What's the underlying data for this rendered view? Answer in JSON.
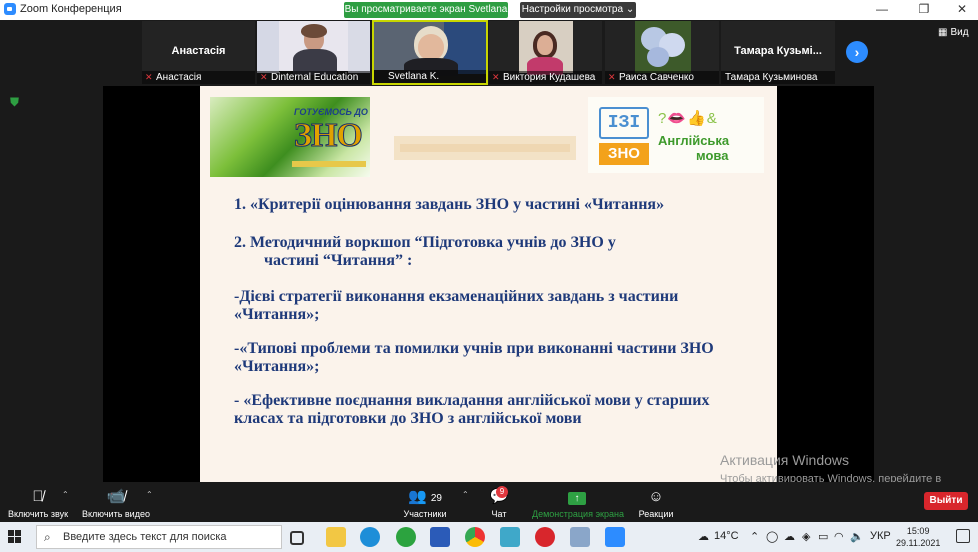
{
  "window": {
    "title": "Zoom Конференция",
    "share_notice": "Вы просматриваете экран Svetlana K",
    "view_options": "Настройки просмотра",
    "controls": [
      "—",
      "❐",
      "✕"
    ]
  },
  "participants": [
    {
      "display": "Анастасія",
      "caption": "Анастасія",
      "video": false
    },
    {
      "display": "",
      "caption": "Dinternal Education",
      "video": true
    },
    {
      "display": "",
      "caption": "Svetlana K.",
      "video": true
    },
    {
      "display": "",
      "caption": "Виктория Кудашева",
      "video": true
    },
    {
      "display": "",
      "caption": "Раиса Савченко",
      "video": true
    },
    {
      "display": "Тамара  Кузьмі...",
      "caption": "Тамара Кузьминова",
      "video": false
    }
  ],
  "view_button": "Вид",
  "slide": {
    "logo_left_top": "ГОТУЄМОСЬ ДО",
    "logo_left_main": "ЗНО",
    "logo_right_box": "ЗНО",
    "logo_right_line1": "Англійська",
    "logo_right_line2": "мова",
    "lines": [
      "1. «Критерії  оцінювання завдань ЗНО у частині «Читання»",
      "2.    Методичний воркшоп  “Підготовка учнів до ЗНО у",
      "частині “Читання” :",
      "-Дієві стратегії виконання екзаменаційних завдань з частини",
      "«Читання»;",
      "-«Типові проблеми та помилки учнів при виконанні частини ЗНО",
      "«Читання»;",
      "- «Ефективне поєднання викладання англійської мови у старших",
      "класах та підготовки до ЗНО з англійської мови"
    ]
  },
  "activation": {
    "title": "Активация Windows",
    "text": "Чтобы активировать Windows, перейдите в раздел \"Параметры\"."
  },
  "toolbar": {
    "mute": "Включить звук",
    "video": "Включить видео",
    "participants": "Участники",
    "participants_count": "29",
    "chat": "Чат",
    "chat_badge": "9",
    "share": "Демонстрация экрана",
    "reactions": "Реакции",
    "leave": "Выйти"
  },
  "taskbar": {
    "search_placeholder": "Введите здесь текст для поиска",
    "temperature": "14°C",
    "lang": "УКР",
    "time": "15:09",
    "date": "29.11.2021"
  }
}
